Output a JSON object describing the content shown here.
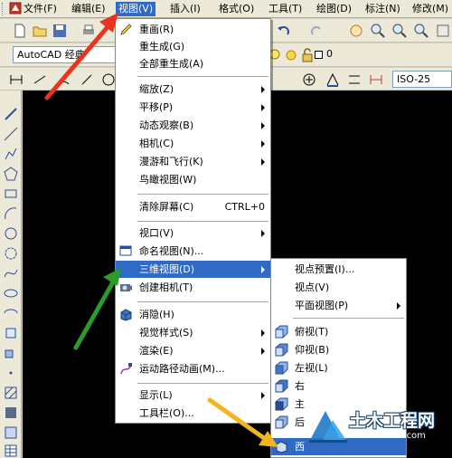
{
  "menubar": {
    "items": [
      "文件(F)",
      "编辑(E)",
      "视图(V)",
      "插入(I)",
      "格式(O)",
      "工具(T)",
      "绘图(D)",
      "标注(N)",
      "修改(M)"
    ]
  },
  "toolbar2": {
    "workspace": "AutoCAD 经典",
    "layer_value": "0"
  },
  "toolbar3": {
    "dimstyle": "ISO-25"
  },
  "view_menu": {
    "items": {
      "redraw": "重画(R)",
      "regen": "重生成(G)",
      "regen_all": "全部重生成(A)",
      "zoom": "缩放(Z)",
      "pan": "平移(P)",
      "orbit": "动态观察(B)",
      "camera": "相机(C)",
      "walkfly": "漫游和飞行(K)",
      "aerial": "鸟瞰视图(W)",
      "clean_screen": "清除屏幕(C)",
      "clean_screen_shortcut": "CTRL+0",
      "viewports": "视口(V)",
      "named_views": "命名视图(N)...",
      "views_3d": "三维视图(D)",
      "create_camera": "创建相机(T)",
      "hide": "消隐(H)",
      "visual_styles": "视觉样式(S)",
      "render": "渲染(E)",
      "motion_path": "运动路径动画(M)...",
      "display": "显示(L)",
      "toolbars": "工具栏(O)..."
    }
  },
  "submenu_3d": {
    "items": {
      "viewpoint_presets": "视点预置(I)...",
      "viewpoint": "视点(V)",
      "plan_view": "平面视图(P)",
      "top": "俯视(T)",
      "bottom": "仰视(B)",
      "left": "左视(L)",
      "right_partial": "右",
      "front_partial": "主",
      "back_partial": "后",
      "sw_partial": "西"
    }
  },
  "watermark": {
    "title": "土木工程网",
    "url": "www.civilcn.com"
  },
  "colors": {
    "highlight": "#316ac5",
    "arrow_red": "#e8341c",
    "arrow_green": "#2e9a2e",
    "arrow_yellow": "#f2b51c"
  }
}
